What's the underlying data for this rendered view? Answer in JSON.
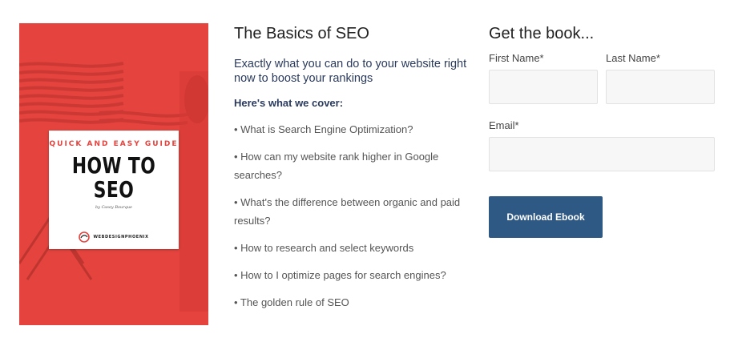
{
  "cover": {
    "tag": "Quick and Easy Guide",
    "title": "HOW TO SEO",
    "author": "by Casey Bourque",
    "brand": "WEBDESIGNPHOENIX",
    "background": "#e5433d"
  },
  "content": {
    "heading": "The Basics of SEO",
    "subtitle": "Exactly what you can do to your website right now to boost your rankings",
    "cover_label": "Here's what we cover:",
    "topics": [
      "• What is Search Engine Optimization?",
      "• How can my website rank higher in Google searches?",
      "• What's the difference between organic and paid results?",
      "• How to research and select keywords",
      "• How to I optimize pages for search engines?",
      "• The golden rule of SEO"
    ]
  },
  "form": {
    "title": "Get the book...",
    "first_name_label": "First Name*",
    "first_name_value": "",
    "last_name_label": "Last Name*",
    "last_name_value": "",
    "email_label": "Email*",
    "email_value": "",
    "submit_label": "Download Ebook",
    "button_color": "#2e5984"
  }
}
